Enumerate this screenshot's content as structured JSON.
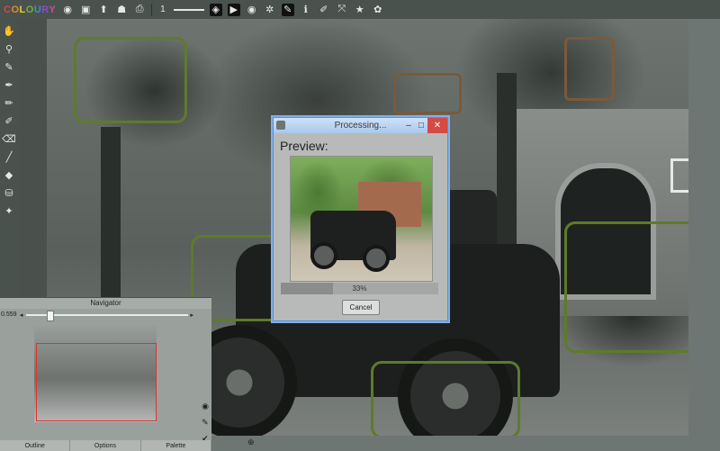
{
  "app": {
    "logo": "COLOURY",
    "brush_size": "1"
  },
  "toolbar_icons": [
    "circle-icon",
    "save-icon",
    "export-icon",
    "person-icon",
    "print-icon",
    "layers-icon",
    "play-icon",
    "eye-icon",
    "gear-icon",
    "pen-icon",
    "info-icon",
    "brush-icon",
    "transform-icon",
    "star-icon",
    "settings-icon"
  ],
  "dialog": {
    "title": "Processing...",
    "preview_label": "Preview:",
    "progress_percent": 33,
    "progress_text": "33%",
    "cancel_label": "Cancel"
  },
  "navigator": {
    "title": "Navigator",
    "zoom": "0.5592%",
    "slider_position": 0.13,
    "tabs": [
      "Outline",
      "Options",
      "Palette"
    ]
  },
  "colors": {
    "accent": "#5a8fd6",
    "outline_green": "#5e7a2c",
    "close_red": "#d44a45"
  }
}
